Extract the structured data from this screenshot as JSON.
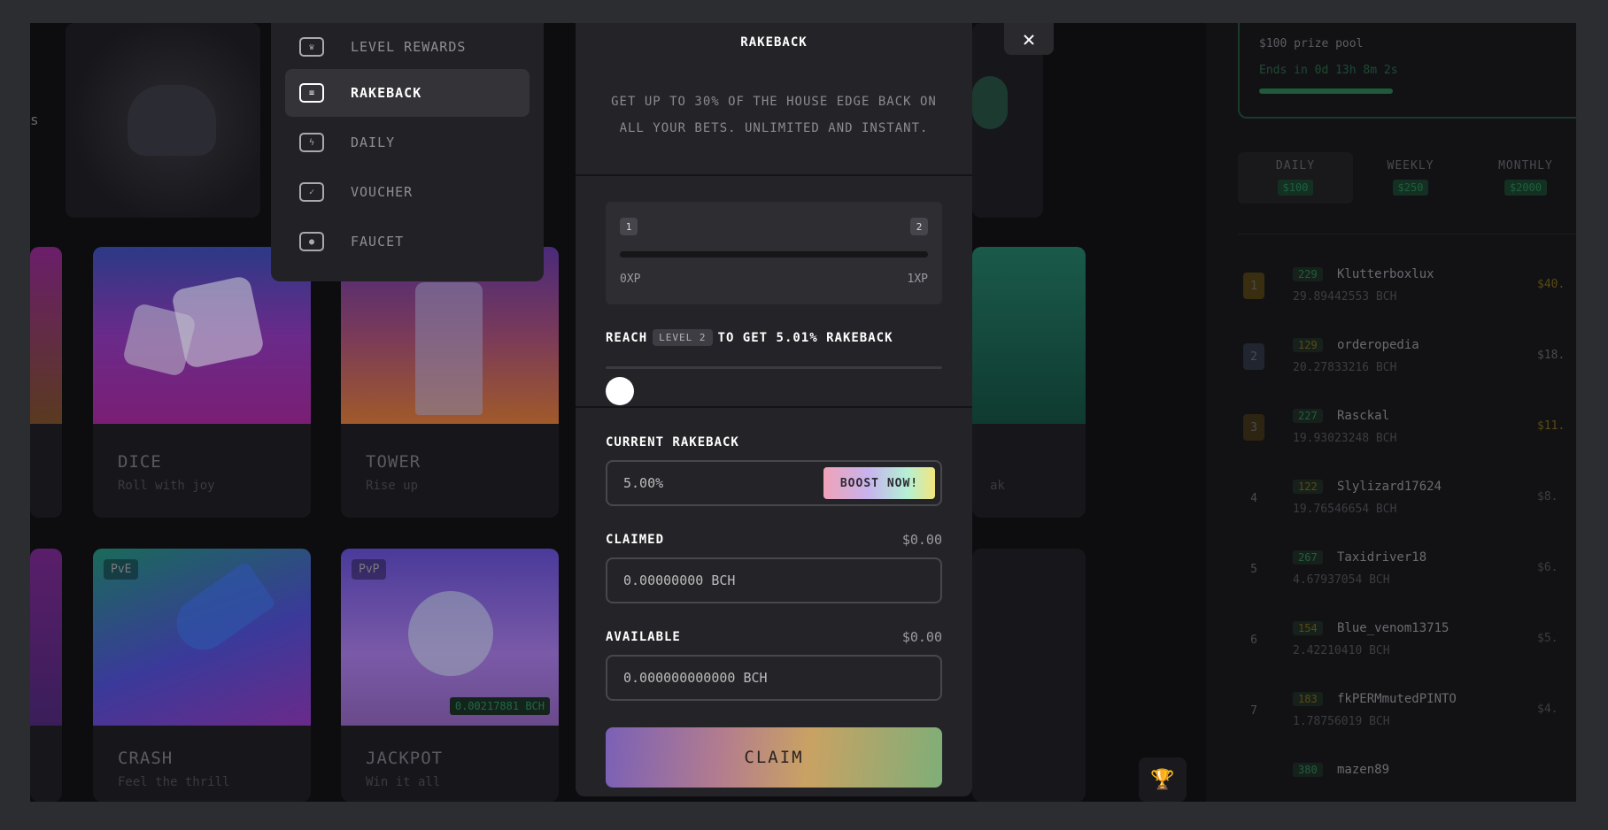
{
  "menu": {
    "items": [
      {
        "label": "LEVEL REWARDS",
        "icon": "crown-icon",
        "glyph": "♛",
        "active": false
      },
      {
        "label": "RAKEBACK",
        "icon": "rakeback-icon",
        "glyph": "≡",
        "active": true
      },
      {
        "label": "DAILY",
        "icon": "lightning-icon",
        "glyph": "ϟ",
        "active": false
      },
      {
        "label": "VOUCHER",
        "icon": "voucher-icon",
        "glyph": "✓",
        "active": false
      },
      {
        "label": "FAUCET",
        "icon": "faucet-icon",
        "glyph": "●",
        "active": false
      }
    ]
  },
  "games": {
    "dice": {
      "name": "DICE",
      "sub": "Roll with joy"
    },
    "tower": {
      "name": "TOWER",
      "sub": "Rise up"
    },
    "crash": {
      "name": "CRASH",
      "sub": "Feel the thrill",
      "tag": "PvE"
    },
    "jackpot": {
      "name": "JACKPOT",
      "sub": "Win it all",
      "tag": "PvP",
      "pot": "0.00217881 BCH"
    },
    "partial_sub": "ak",
    "partial_left": "s"
  },
  "modal": {
    "title": "RAKEBACK",
    "description": "GET UP TO 30% OF THE HOUSE EDGE BACK ON ALL YOUR BETS. UNLIMITED AND INSTANT.",
    "progress": {
      "level_from": "1",
      "level_to": "2",
      "xp_from": "0XP",
      "xp_to": "1XP",
      "fraction": 0
    },
    "reach": {
      "prefix": "REACH",
      "level": "LEVEL 2",
      "suffix": "TO GET 5.01% RAKEBACK"
    },
    "current": {
      "label": "CURRENT RAKEBACK",
      "value": "5.00%",
      "boost_label": "BOOST NOW!"
    },
    "claimed": {
      "label": "CLAIMED",
      "usd": "$0.00",
      "value": "0.00000000 BCH"
    },
    "available": {
      "label": "AVAILABLE",
      "usd": "$0.00",
      "value": "0.000000000000 BCH"
    },
    "claim_label": "CLAIM",
    "close_glyph": "✕"
  },
  "leaderboard": {
    "prize_pool": "$100 prize pool",
    "ends_in": "Ends in 0d 13h 8m 2s",
    "prize_progress": 0.42,
    "tabs": [
      {
        "label": "DAILY",
        "value": "$100",
        "active": true
      },
      {
        "label": "WEEKLY",
        "value": "$250",
        "active": false
      },
      {
        "label": "MONTHLY",
        "value": "$2000",
        "active": false
      }
    ],
    "rows": [
      {
        "rank": "1",
        "level": "229",
        "name": "Klutterboxlux",
        "amount": "29.89442553 BCH",
        "usd": "$40.",
        "level_color": "#1f5f3e",
        "usd_color": "#5a4a12",
        "medal": "#3a2e10"
      },
      {
        "rank": "2",
        "level": "129",
        "name": "orderopedia",
        "amount": "20.27833216 BCH",
        "usd": "$18.",
        "level_color": "#5a4a12",
        "usd_color": "#4a4a50",
        "medal": "#202530"
      },
      {
        "rank": "3",
        "level": "227",
        "name": "Rasckal",
        "amount": "19.93023248 BCH",
        "usd": "$11.",
        "level_color": "#1f5f3e",
        "usd_color": "#5a4a12",
        "medal": "#2e2412"
      },
      {
        "rank": "4",
        "level": "122",
        "name": "Slylizard17624",
        "amount": "19.76546654 BCH",
        "usd": "$8.",
        "level_color": "#5a4a12",
        "usd_color": "#3c3c42",
        "medal": ""
      },
      {
        "rank": "5",
        "level": "267",
        "name": "Taxidriver18",
        "amount": "4.67937054 BCH",
        "usd": "$6.",
        "level_color": "#1f5f3e",
        "usd_color": "#3c3c42",
        "medal": ""
      },
      {
        "rank": "6",
        "level": "154",
        "name": "Blue_venom13715",
        "amount": "2.42210410 BCH",
        "usd": "$5.",
        "level_color": "#5a4a12",
        "usd_color": "#3c3c42",
        "medal": ""
      },
      {
        "rank": "7",
        "level": "183",
        "name": "fkPERMmutedPINTO",
        "amount": "1.78756019 BCH",
        "usd": "$4.",
        "level_color": "#5a4a12",
        "usd_color": "#3c3c42",
        "medal": ""
      },
      {
        "rank": "",
        "level": "380",
        "name": "mazen89",
        "amount": "",
        "usd": "",
        "level_color": "#1f5f3e",
        "usd_color": "#3c3c42",
        "medal": ""
      }
    ]
  },
  "trophy_glyph": "🏆"
}
